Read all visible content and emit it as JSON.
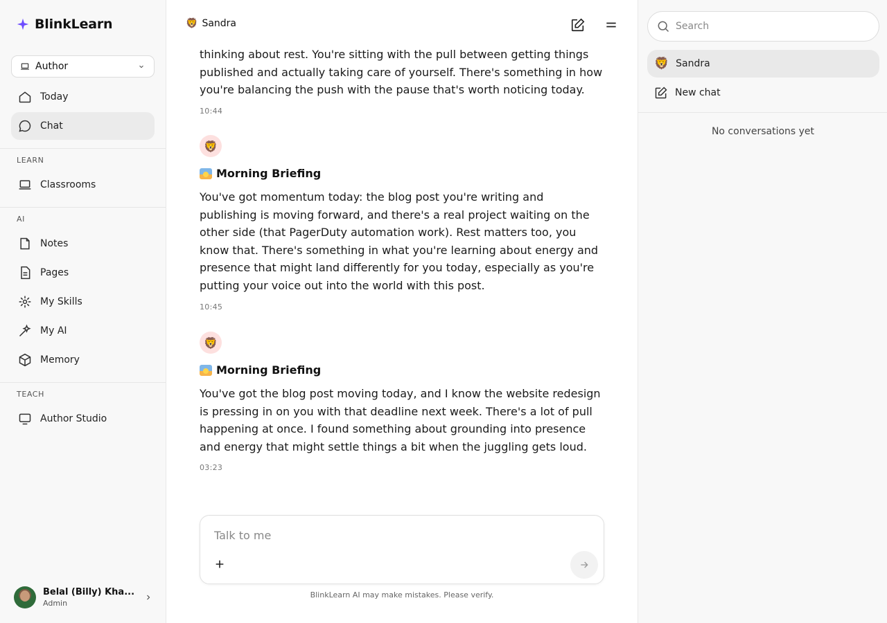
{
  "app": {
    "name": "BlinkLearn",
    "accent": "#6d4cff"
  },
  "sidebar": {
    "role_select": {
      "value": "Author"
    },
    "items_top": [
      {
        "label": "Today",
        "icon": "home-icon"
      },
      {
        "label": "Chat",
        "icon": "chat-bubble-icon",
        "active": true
      }
    ],
    "sections": [
      {
        "label": "LEARN",
        "items": [
          {
            "label": "Classrooms",
            "icon": "laptop-icon"
          }
        ]
      },
      {
        "label": "AI",
        "items": [
          {
            "label": "Notes",
            "icon": "note-icon"
          },
          {
            "label": "Pages",
            "icon": "document-icon"
          },
          {
            "label": "My Skills",
            "icon": "sparkle-burst-icon"
          },
          {
            "label": "My AI",
            "icon": "magic-wand-icon"
          },
          {
            "label": "Memory",
            "icon": "cube-icon"
          }
        ]
      },
      {
        "label": "TEACH",
        "items": [
          {
            "label": "Author Studio",
            "icon": "monitor-icon"
          }
        ]
      }
    ],
    "user": {
      "name": "Belal (Billy) Kha...",
      "role": "Admin"
    }
  },
  "chat": {
    "title": "Sandra",
    "messages": [
      {
        "text": "thinking about rest. You're sitting with the pull between getting things published and actually taking care of yourself. There's something in how you're balancing the push with the pause that's worth noticing today.",
        "time": "10:44"
      },
      {
        "heading": "Morning Briefing",
        "text": "You've got momentum today: the blog post you're writing and publishing is moving forward, and there's a real project waiting on the other side (that PagerDuty automation work). Rest matters too, you know that. There's something in what you're learning about energy and presence that might land differently for you today, especially as you're putting your voice out into the world with this post.",
        "time": "10:45"
      },
      {
        "heading": "Morning Briefing",
        "text": "You've got the blog post moving today, and I know the website redesign is pressing in on you with that deadline next week. There's a lot of pull happening at once. I found something about grounding into presence and energy that might settle things a bit when the juggling gets loud.",
        "time": "03:23"
      }
    ],
    "composer": {
      "placeholder": "Talk to me"
    },
    "disclaimer": "BlinkLearn AI may make mistakes. Please verify."
  },
  "right_panel": {
    "search": {
      "placeholder": "Search"
    },
    "items": [
      {
        "label": "Sandra",
        "active": true
      },
      {
        "label": "New chat"
      }
    ],
    "empty_state": "No conversations yet"
  }
}
